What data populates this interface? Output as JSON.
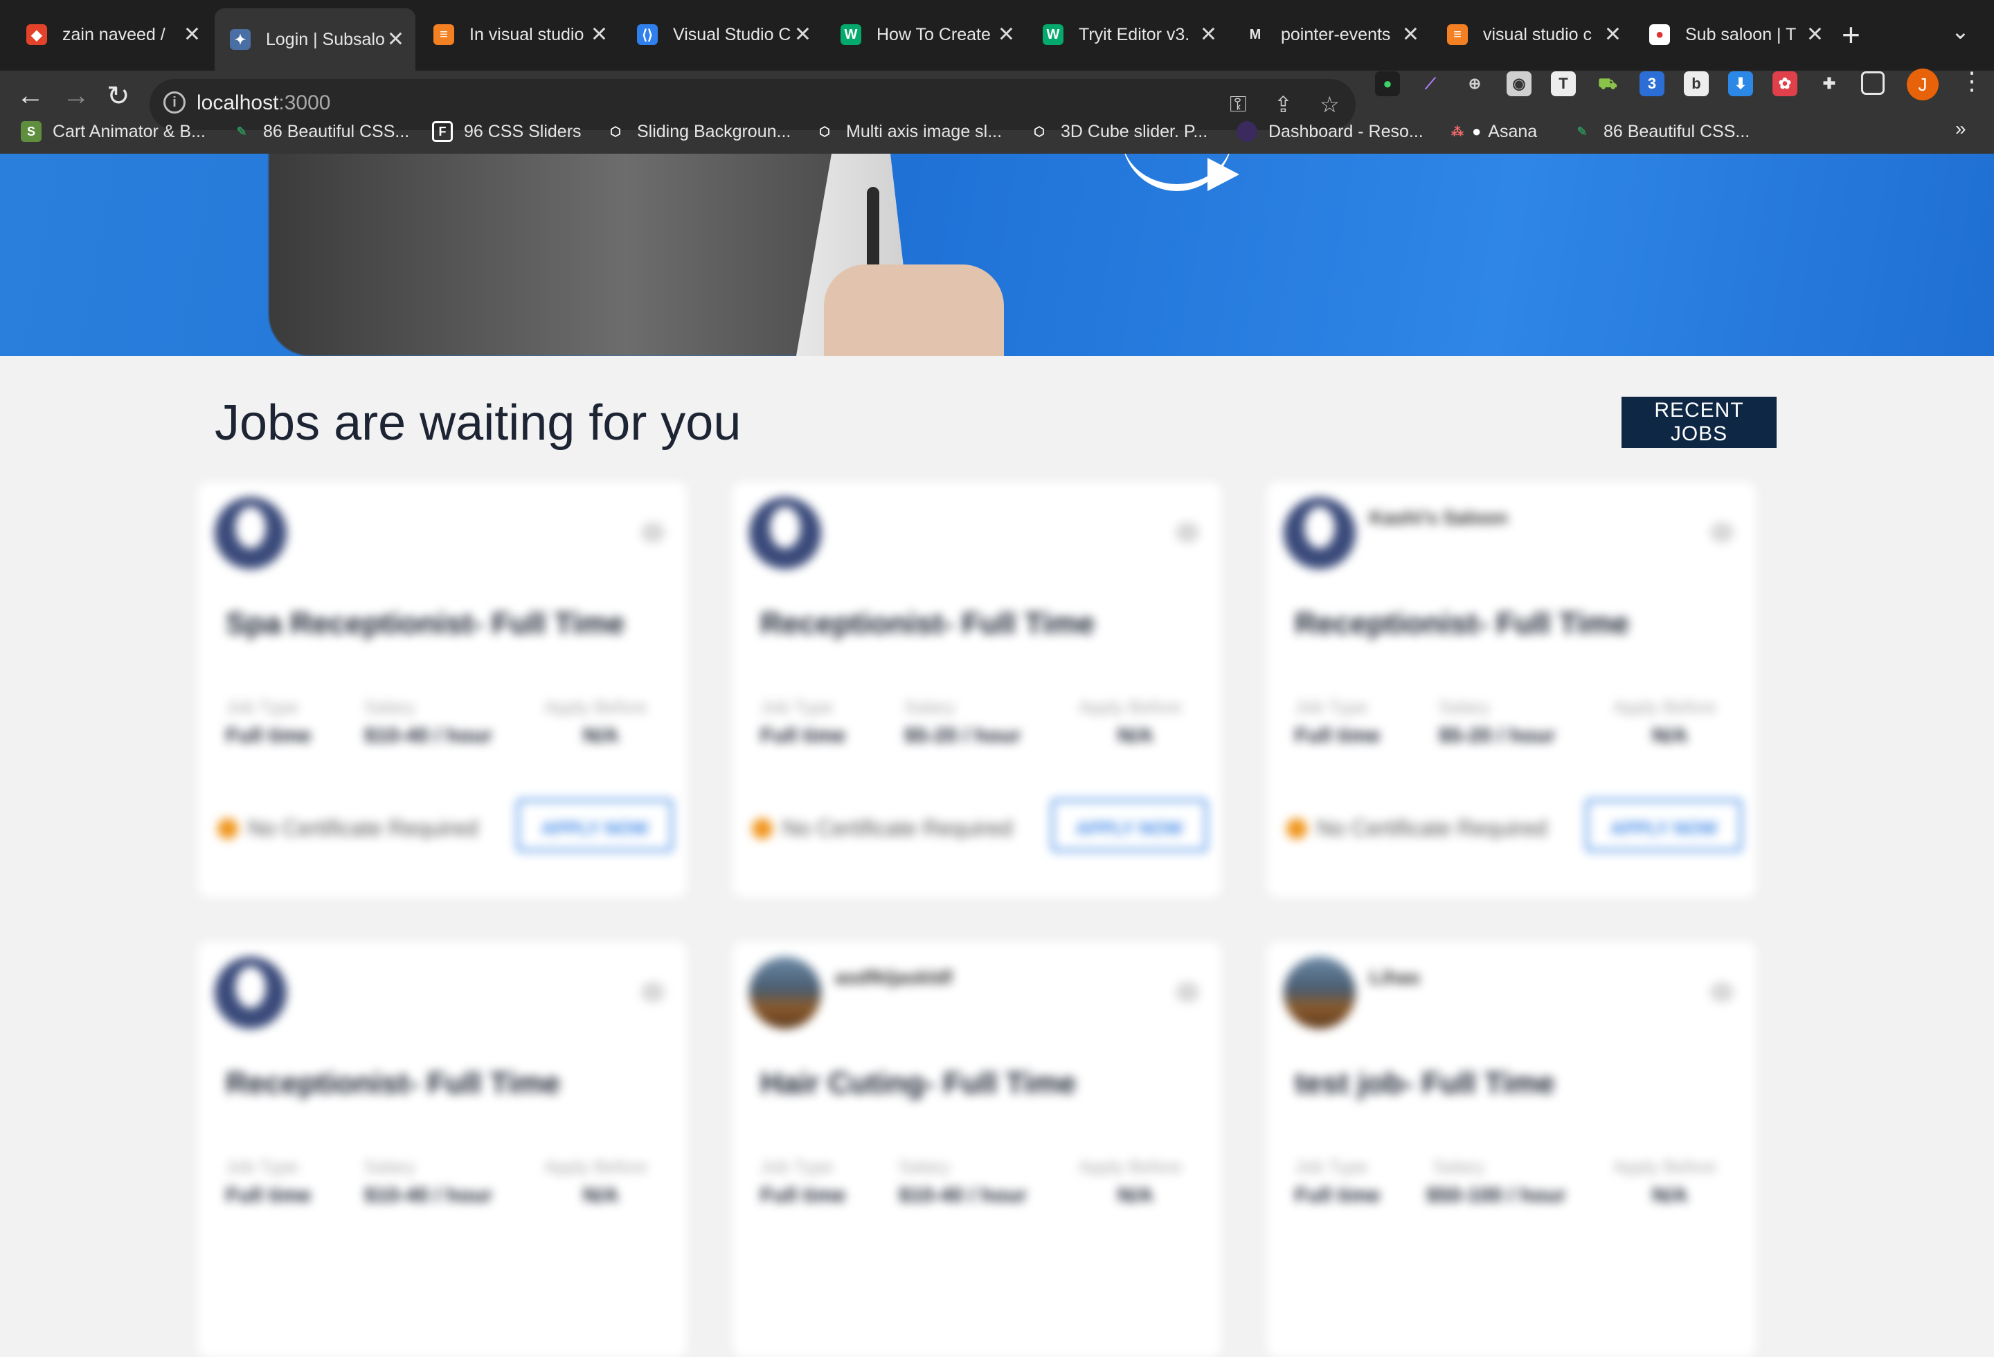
{
  "browser": {
    "tabs": [
      {
        "title": "zain naveed / ",
        "icon": "gitlab-icon",
        "color": "#e2432a"
      },
      {
        "title": "Login | Subsalo",
        "icon": "site-favicon",
        "color": "#4a6fa5",
        "active": true
      },
      {
        "title": "In visual studio",
        "icon": "stackoverflow-icon",
        "color": "#f48024"
      },
      {
        "title": "Visual Studio C",
        "icon": "vscode-icon",
        "color": "#2f80ed"
      },
      {
        "title": "How To Create",
        "icon": "w3schools-icon",
        "color": "#04aa6d"
      },
      {
        "title": "Tryit Editor v3.",
        "icon": "w3schools-icon",
        "color": "#04aa6d"
      },
      {
        "title": "pointer-events",
        "icon": "mdn-icon",
        "color": "#e6e6e6"
      },
      {
        "title": "visual studio c",
        "icon": "stackoverflow-icon",
        "color": "#f48024"
      },
      {
        "title": "Sub saloon | T",
        "icon": "subsaloon-icon",
        "color": "#ffffff"
      }
    ],
    "address": {
      "host": "localhost",
      "port": ":3000"
    },
    "bookmarks": [
      {
        "label": "Cart Animator & B...",
        "icon": "shopify-icon",
        "color": "#5e8e3e"
      },
      {
        "label": "86 Beautiful CSS...",
        "icon": "bookmark-favicon",
        "color": "#2e8b57"
      },
      {
        "label": "96 CSS Sliders",
        "icon": "freefrontend-icon",
        "color": "#ffffff"
      },
      {
        "label": "Sliding Backgroun...",
        "icon": "codepen-icon",
        "color": "#ffffff"
      },
      {
        "label": "Multi axis image sl...",
        "icon": "codepen-icon",
        "color": "#ffffff"
      },
      {
        "label": "3D Cube slider. P...",
        "icon": "codepen-icon",
        "color": "#ffffff"
      },
      {
        "label": "Dashboard - Reso...",
        "icon": "dashboard-icon",
        "color": "#6a3fb5"
      },
      {
        "label": "Asana",
        "icon": "asana-icon",
        "color": "#f06a6a"
      },
      {
        "label": "86 Beautiful CSS...",
        "icon": "bookmark-favicon",
        "color": "#2e8b57"
      }
    ],
    "profile_initial": "J"
  },
  "page": {
    "section_title": "Jobs are waiting for you",
    "recent_jobs_label": "RECENT JOBS",
    "labels": {
      "job_type": "Job Type",
      "salary": "Salary",
      "apply_before": "Apply Before",
      "certificate": "No Certificate Required",
      "apply": "APPLY NOW"
    },
    "jobs": [
      {
        "owner": "",
        "title": "Spa Receptionist- Full Time",
        "job_type": "Full time",
        "salary": "$10-40 / hour",
        "apply_before": "N/A",
        "avatar": "placeholder"
      },
      {
        "owner": "",
        "title": "Receptionist- Full Time",
        "job_type": "Full time",
        "salary": "$5-20 / hour",
        "apply_before": "N/A",
        "avatar": "placeholder"
      },
      {
        "owner": "Kashi's Saloon",
        "title": "Receptionist- Full Time",
        "job_type": "Full time",
        "salary": "$5-20 / hour",
        "apply_before": "N/A",
        "avatar": "placeholder"
      },
      {
        "owner": "",
        "title": "Receptionist- Full Time",
        "job_type": "Full time",
        "salary": "$10-40 / hour",
        "apply_before": "N/A",
        "avatar": "placeholder"
      },
      {
        "owner": "asdfkljaskldf",
        "title": "Hair Cuting- Full Time",
        "job_type": "Full time",
        "salary": "$10-40 / hour",
        "apply_before": "N/A",
        "avatar": "photo"
      },
      {
        "owner": "Lihas",
        "title": "test job- Full Time",
        "job_type": "Full time",
        "salary": "$50-100 / hour",
        "apply_before": "N/A",
        "avatar": "photo"
      }
    ],
    "colors": {
      "hero_blue": "#1f71d6",
      "button_navy": "#0d2744",
      "apply_blue": "#3b86e6",
      "dot_orange": "#f0961e"
    }
  }
}
